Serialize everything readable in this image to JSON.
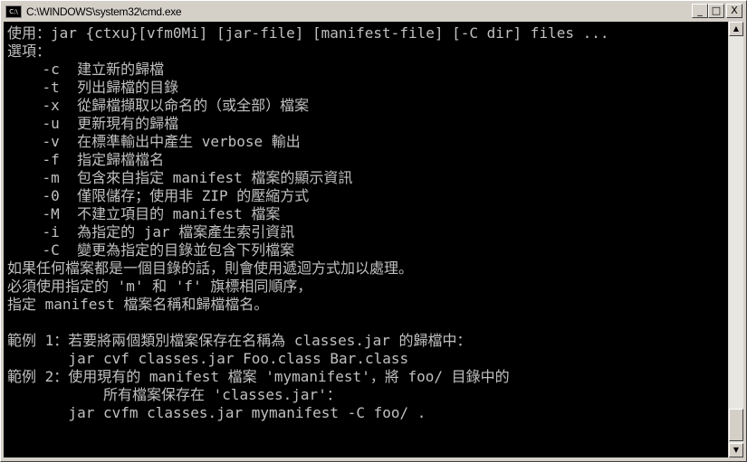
{
  "window": {
    "title": "C:\\WINDOWS\\system32\\cmd.exe",
    "icon_label": "C:\\",
    "minimize": "_",
    "maximize": "□",
    "close": "X"
  },
  "console": {
    "lines": [
      "使用：jar {ctxu}[vfm0Mi] [jar-file] [manifest-file] [-C dir] files ...",
      "選項：",
      "    -c  建立新的歸檔",
      "    -t  列出歸檔的目錄",
      "    -x  從歸檔擷取以命名的（或全部）檔案",
      "    -u  更新現有的歸檔",
      "    -v  在標準輸出中產生 verbose 輸出",
      "    -f  指定歸檔檔名",
      "    -m  包含來自指定 manifest 檔案的顯示資訊",
      "    -0  僅限儲存；使用非 ZIP 的壓縮方式",
      "    -M  不建立項目的 manifest 檔案",
      "    -i  為指定的 jar 檔案產生索引資訊",
      "    -C  變更為指定的目錄並包含下列檔案",
      "如果任何檔案都是一個目錄的話，則會使用遞迴方式加以處理。",
      "必須使用指定的 'm' 和 'f' 旗標相同順序，",
      "指定 manifest 檔案名稱和歸檔檔名。",
      "",
      "範例 1：若要將兩個類別檔案保存在名稱為 classes.jar 的歸檔中：",
      "       jar cvf classes.jar Foo.class Bar.class",
      "範例 2：使用現有的 manifest 檔案 'mymanifest'，將 foo/ 目錄中的",
      "           所有檔案保存在 'classes.jar'：",
      "       jar cvfm classes.jar mymanifest -C foo/ ."
    ]
  },
  "scrollbar": {
    "up": "▲",
    "down": "▼",
    "position": 0.95
  }
}
